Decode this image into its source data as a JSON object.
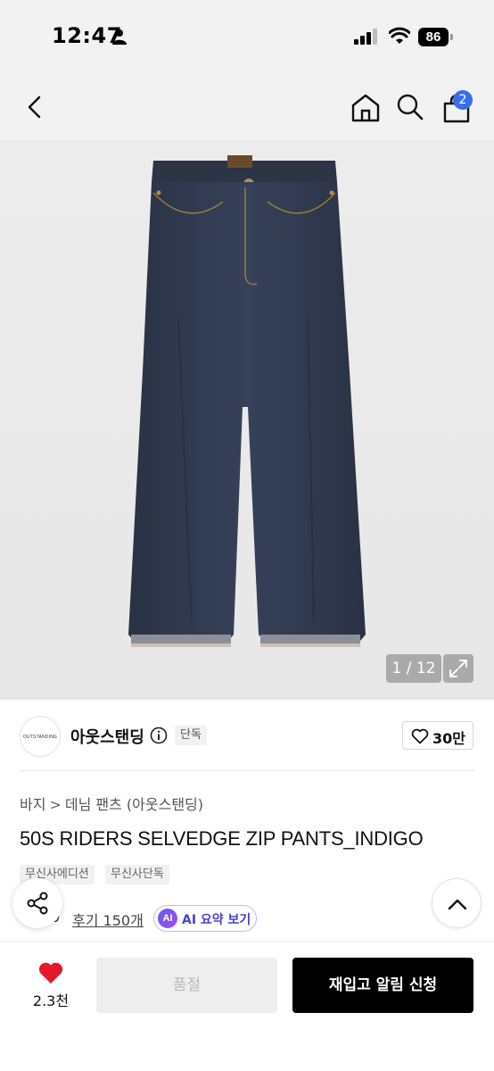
{
  "status_bar": {
    "time": "12:47",
    "battery": "86"
  },
  "nav": {
    "cart_count": "2"
  },
  "gallery": {
    "counter": "1 / 12"
  },
  "brand": {
    "logo_text": "OUTSTANDING",
    "name": "아웃스탠딩",
    "exclusive_badge": "단독",
    "like_count": "30만"
  },
  "breadcrumb": {
    "items": [
      "바지",
      "데님 팬츠 (아웃스탠딩)"
    ],
    "separator": ">"
  },
  "product": {
    "title": "50S RIDERS SELVEDGE ZIP PANTS_INDIGO",
    "tags": [
      "무신사에디션",
      "무신사단독"
    ],
    "rating_value": ".9",
    "review_link": "후기 150개",
    "ai_chip": "AI",
    "ai_label": "AI 요약 보기"
  },
  "bottom_bar": {
    "wish_count": "2.3천",
    "soldout_label": "품절",
    "restock_label": "재입고 알림 신청"
  },
  "colors": {
    "accent_blue": "#3a6cf0",
    "heart_red": "#e4162c",
    "ai_purple": "#4a3fd0",
    "denim": "#2c3446"
  },
  "icons": [
    "person-icon",
    "signal-icon",
    "wifi-icon",
    "back-icon",
    "home-icon",
    "search-icon",
    "cart-icon",
    "expand-icon",
    "info-icon",
    "heart-outline-icon",
    "star-icon",
    "share-icon",
    "chevron-up-icon",
    "heart-filled-icon"
  ]
}
